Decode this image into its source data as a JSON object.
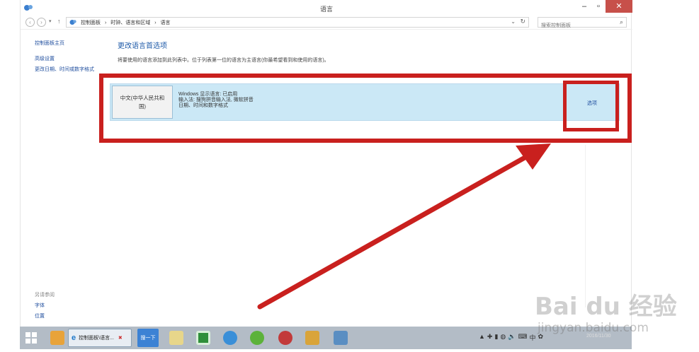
{
  "window": {
    "title": "语言",
    "minimize": "–",
    "maximize": "▫",
    "close": "✕"
  },
  "addressbar": {
    "back": "‹",
    "forward": "›",
    "down": "▾",
    "up": "↑",
    "breadcrumb": [
      "控制面板",
      "›",
      "时钟、语言和区域",
      "›",
      "语言"
    ],
    "dropdown": "⌄",
    "refresh": "↻",
    "search_placeholder": "搜索控制面板",
    "search_icon": "⌕"
  },
  "leftpane": {
    "home": "控制面板主页",
    "links": [
      "高级设置",
      "更改日期、时间或数字格式"
    ],
    "seealso_title": "另请参阅",
    "seealso": [
      "字体",
      "位置"
    ]
  },
  "main": {
    "heading": "更改语言首选项",
    "description": "将要使用的语言添加到此列表中。位于列表第一位的语言为主语言(你最希望看到和使用的语言)。",
    "language": {
      "name": "中文(中华人民共和国)",
      "details": [
        "Windows 显示语言: 已启用",
        "输入法: 搜狗拼音输入法, 微软拼音",
        "日期、时间和数字格式"
      ],
      "options": "选项"
    }
  },
  "taskbar": {
    "ie_task_label": "控制面板\\语言...",
    "ie_glyph": "e",
    "ie_close": "✖",
    "blue_task_label": "搜一下",
    "tray_icons": [
      "▲",
      "✚",
      "▮",
      "◍",
      "🔊",
      "⌨",
      "中",
      "✿"
    ],
    "clock": "2016/11/30"
  },
  "watermark": {
    "logo": "Bai du 经验",
    "url": "jingyan.baidu.com"
  },
  "colors": {
    "annotation_red": "#c9201e",
    "selected_row": "#cbe8f6",
    "link_blue": "#1f4e9e"
  }
}
